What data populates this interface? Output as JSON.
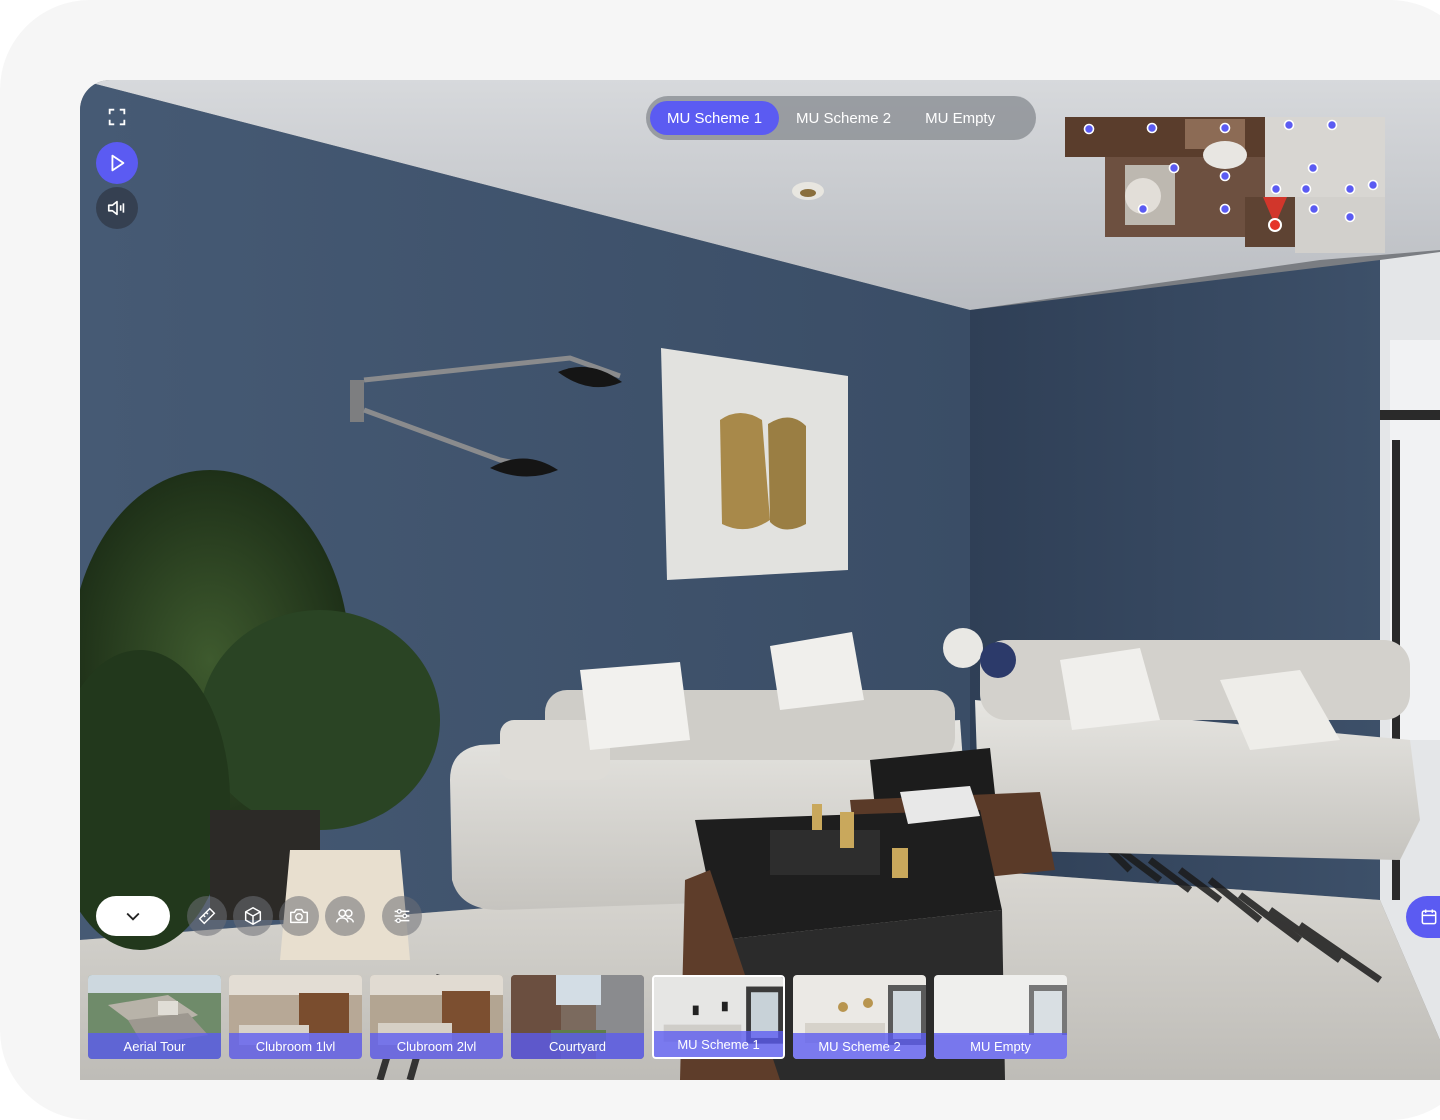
{
  "scheme_tabs": [
    {
      "label": "MU Scheme 1",
      "active": true
    },
    {
      "label": "MU Scheme 2",
      "active": false
    },
    {
      "label": "MU Empty",
      "active": false
    }
  ],
  "left_controls": {
    "fullscreen_icon": "fullscreen-icon",
    "play_icon": "play-icon",
    "sound_icon": "volume-icon"
  },
  "toolbar_icons": [
    "ruler-icon",
    "cube-icon",
    "camera-icon",
    "users-icon",
    "sliders-icon"
  ],
  "thumbnails": [
    {
      "label": "Aerial Tour",
      "active": false
    },
    {
      "label": "Clubroom 1lvl",
      "active": false
    },
    {
      "label": "Clubroom 2lvl",
      "active": false
    },
    {
      "label": "Courtyard",
      "active": false
    },
    {
      "label": "MU Scheme 1",
      "active": true
    },
    {
      "label": "MU Scheme 2",
      "active": false
    },
    {
      "label": "MU Empty",
      "active": false
    }
  ],
  "colors": {
    "accent": "#5b5bf2",
    "wall": "#3f5573",
    "sofa": "#d9d8d4",
    "current_position": "#e5342a"
  }
}
